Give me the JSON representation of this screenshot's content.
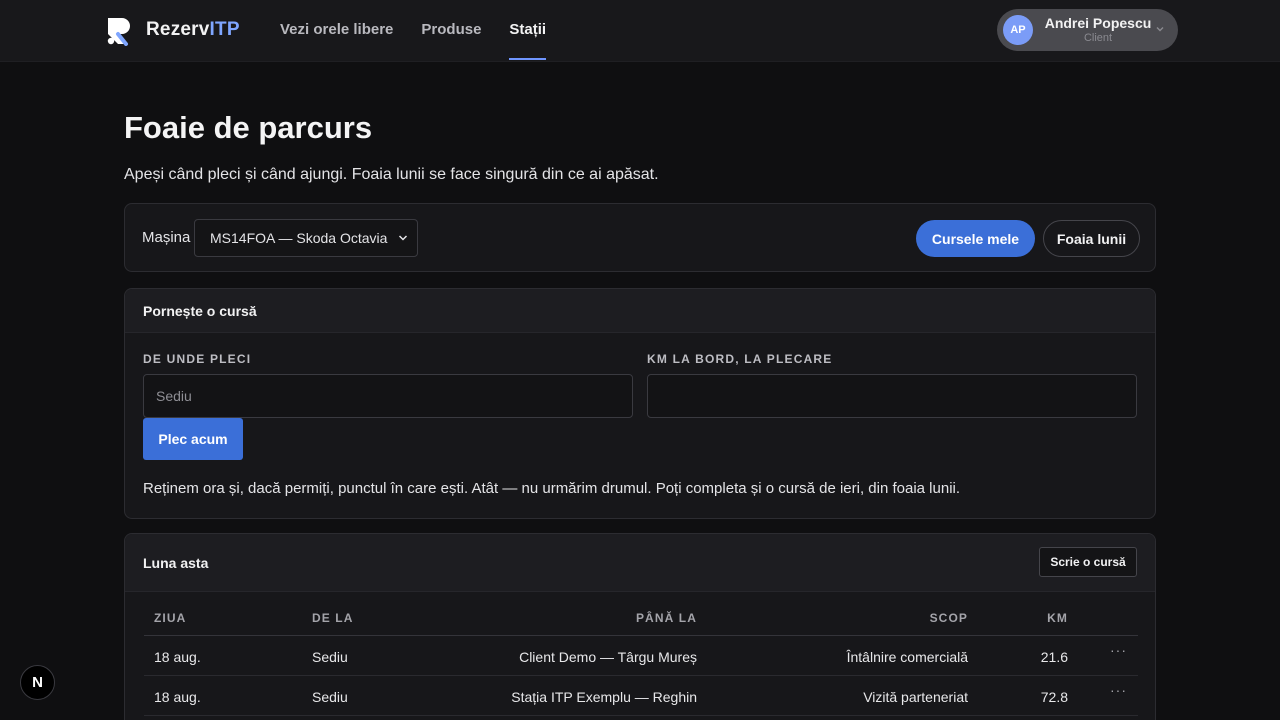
{
  "brand": {
    "name_main": "Rezerv",
    "name_accent": "ITP",
    "logo_icon": "r-logo-icon",
    "accent_color": "#7fa6ff"
  },
  "nav": {
    "items": [
      {
        "label": "Vezi orele libere",
        "active": false
      },
      {
        "label": "Produse",
        "active": false
      },
      {
        "label": "Stații",
        "active": true
      }
    ]
  },
  "user": {
    "initials": "AP",
    "name": "Andrei Popescu",
    "role": "Client"
  },
  "page": {
    "title": "Foaie de parcurs",
    "subtitle": "Apeși când pleci și când ajungi. Foaia lunii se face singură din ce ai apăsat."
  },
  "car_selector": {
    "label": "Mașina",
    "selected": "MS14FOA — Skoda Octavia",
    "my_trips_label": "Cursele mele",
    "month_sheet_label": "Foaia lunii"
  },
  "start_trip": {
    "title": "Pornește o cursă",
    "from_label": "DE UNDE PLECI",
    "from_placeholder": "Sediu",
    "km_label": "KM LA BORD, LA PLECARE",
    "km_value": "",
    "start_button": "Plec acum",
    "note": "Reținem ora și, dacă permiți, punctul în care ești. Atât — nu urmărim drumul. Poți completa și o cursă de ieri, din foaia lunii."
  },
  "month": {
    "title": "Luna asta",
    "write_button": "Scrie o cursă",
    "columns": [
      "ZIUA",
      "DE LA",
      "PÂNĂ LA",
      "SCOP",
      "KM"
    ],
    "rows": [
      {
        "day": "18 aug.",
        "from": "Sediu",
        "to": "Client Demo — Târgu Mureș",
        "scope": "Întâlnire comercială",
        "km": "21.6"
      },
      {
        "day": "18 aug.",
        "from": "Sediu",
        "to": "Stația ITP Exemplu — Reghin",
        "scope": "Vizită parteneriat",
        "km": "72.8"
      }
    ]
  },
  "colors": {
    "primary": "#3b6fd8",
    "background": "#0f0f11",
    "card": "#17171a"
  }
}
